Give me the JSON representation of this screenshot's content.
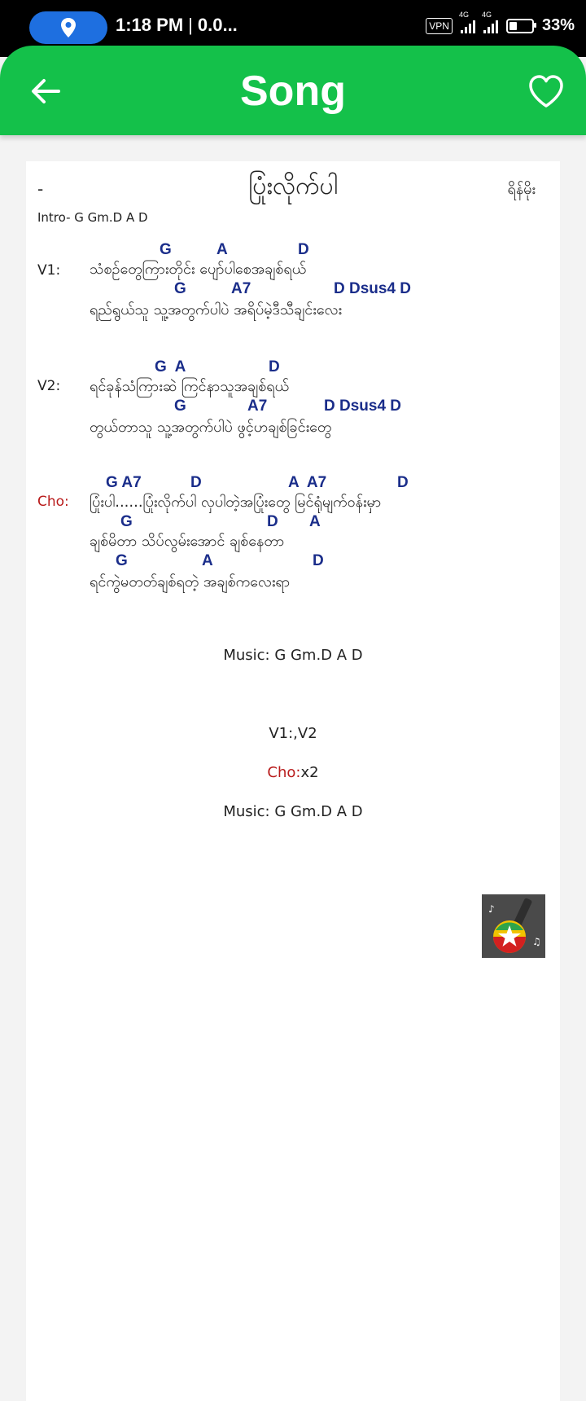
{
  "status_bar": {
    "time": "1:18 PM",
    "separator": "|",
    "data_rate": "0.0...",
    "vpn": "VPN",
    "net1": "4G",
    "net2": "4G",
    "battery_pct": "33%",
    "battery_level": 0.33
  },
  "appbar": {
    "title": "Song",
    "back_icon": "arrow-left-icon",
    "fav_icon": "heart-outline-icon",
    "color": "#14c14a"
  },
  "song": {
    "dash": "-",
    "title": "ပြုံးလိုက်ပါ",
    "artist": "ရိန်မိုး",
    "intro": "Intro- G Gm.D A D"
  },
  "sections": [
    {
      "label": "V1:",
      "lines": [
        {
          "chords": [
            "G",
            "A",
            "D"
          ],
          "lyric": "သံစဉ်တွေကြားတိုင်း ပျော်ပါစေအချစ်ရယ်"
        },
        {
          "chords": [
            "G",
            "A7",
            "D Dsus4 D"
          ],
          "lyric": "ရည်ရွယ်သူ သူ့အတွက်ပါပဲ အရိပ်မဲ့ဒီသီချင်းလေး"
        }
      ]
    },
    {
      "label": "V2:",
      "lines": [
        {
          "chords": [
            "G  A",
            "D"
          ],
          "lyric": "ရင်ခုန်သံကြားဆဲ ကြင်နာသူအချစ်ရယ်"
        },
        {
          "chords": [
            "G",
            "A7",
            "D Dsus4 D"
          ],
          "lyric": "တွယ်တာသူ သူ့အတွက်ပါပဲ ဖွင့်ဟချစ်ခြင်းတွေ"
        }
      ]
    },
    {
      "label": "Cho:",
      "lines": [
        {
          "chords": [
            "G A7",
            "D",
            "A  A7",
            "D"
          ],
          "lyric": "ပြုံးပါ......ပြုံးလိုက်ပါ လှပါတဲ့အပြုံးတွေ မြင်ရုံမျက်ဝန်းမှာ"
        },
        {
          "chords": [
            "G",
            "D",
            "A"
          ],
          "lyric": "ချစ်မိတာ သိပ်လွမ်းအောင် ချစ်နေတာ"
        },
        {
          "chords": [
            "G",
            "A",
            "D"
          ],
          "lyric": "ရင်ကွဲမတတ်ချစ်ရတဲ့ အချစ်ကလေးရာ"
        }
      ]
    }
  ],
  "footer": {
    "music1": "Music: G Gm.D  A D",
    "order": "V1:,V2",
    "cho_label": "Cho:",
    "cho_repeat": "x2",
    "music2": "Music: G Gm.D  A D"
  },
  "logo_icon": "guitar-myanmar-flag-logo"
}
